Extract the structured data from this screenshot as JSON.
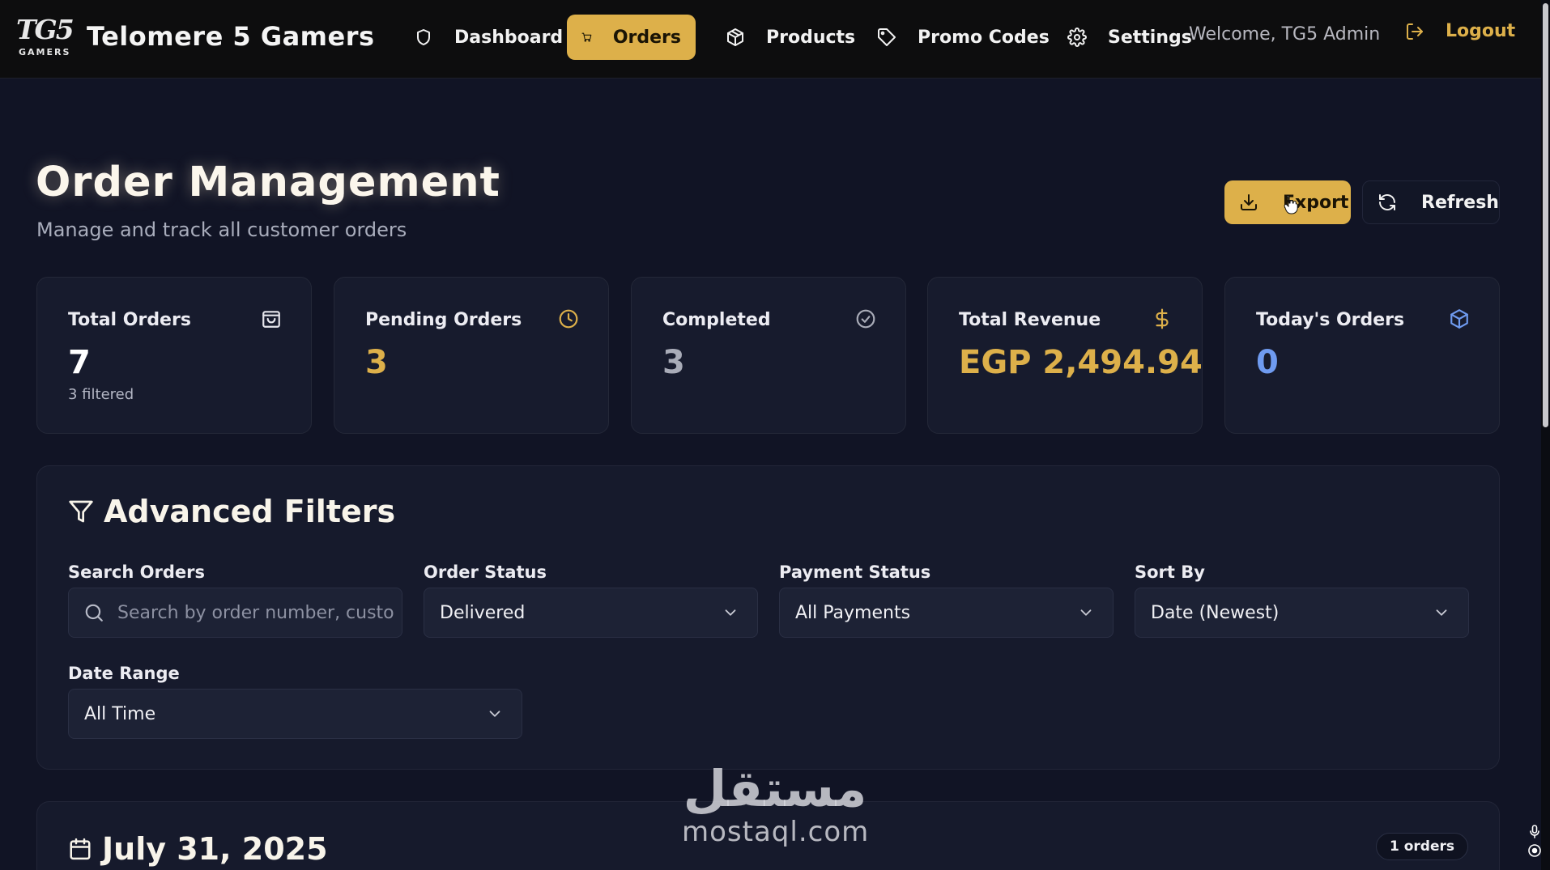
{
  "navbar": {
    "logo_text": "TG5",
    "logo_sub": "GAMERS",
    "brand": "Telomere 5 Gamers",
    "items": [
      {
        "label": "Dashboard",
        "icon": "shield-icon"
      },
      {
        "label": "Orders",
        "icon": "cart-icon",
        "active": true
      },
      {
        "label": "Products",
        "icon": "package-icon"
      },
      {
        "label": "Promo Codes",
        "icon": "tag-icon"
      },
      {
        "label": "Settings",
        "icon": "gear-icon"
      }
    ],
    "welcome": "Welcome, TG5 Admin",
    "logout": "Logout"
  },
  "header": {
    "title": "Order Management",
    "subtitle": "Manage and track all customer orders",
    "export_label": "Export",
    "refresh_label": "Refresh"
  },
  "stats": [
    {
      "label": "Total Orders",
      "value": "7",
      "sub": "3 filtered",
      "icon": "shopping-bag-icon",
      "color": "#ffffff"
    },
    {
      "label": "Pending Orders",
      "value": "3",
      "icon": "clock-icon",
      "color": "#ddb04a"
    },
    {
      "label": "Completed",
      "value": "3",
      "icon": "check-circle-icon",
      "color": "#a9acb8"
    },
    {
      "label": "Total Revenue",
      "value": "EGP 2,494.94",
      "icon": "dollar-icon",
      "color": "#ddb04a"
    },
    {
      "label": "Today's Orders",
      "value": "0",
      "icon": "box-icon",
      "color": "#6f9bf0"
    }
  ],
  "filters": {
    "title": "Advanced Filters",
    "search_label": "Search Orders",
    "search_placeholder": "Search by order number, customer name...",
    "search_value": "",
    "order_status_label": "Order Status",
    "order_status_value": "Delivered",
    "payment_status_label": "Payment Status",
    "payment_status_value": "All Payments",
    "sort_label": "Sort By",
    "sort_value": "Date (Newest)",
    "date_range_label": "Date Range",
    "date_range_value": "All Time"
  },
  "date_group": {
    "date": "July 31, 2025",
    "count_badge": "1 orders"
  },
  "watermark": {
    "arabic": "مستقل",
    "latin": "mostaql.com"
  },
  "colors": {
    "accent": "#ddb04a",
    "background": "#111425",
    "card": "#171b2d",
    "navbar": "#0d0d0e"
  }
}
